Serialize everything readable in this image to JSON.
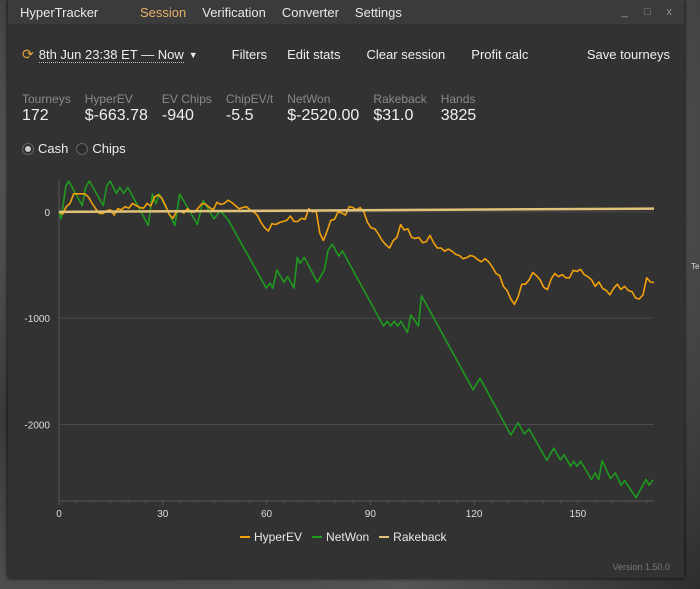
{
  "window": {
    "app_title": "HyperTracker",
    "nav": [
      "Session",
      "Verification",
      "Converter",
      "Settings"
    ],
    "active_nav": "Session",
    "controls": {
      "minimize": "_",
      "maximize": "□",
      "close": "x"
    }
  },
  "toolbar": {
    "date_range": "8th Jun 23:38 ET — Now",
    "filters": "Filters",
    "edit_stats": "Edit stats",
    "clear_session": "Clear session",
    "profit_calc": "Profit calc",
    "save_tourneys": "Save tourneys"
  },
  "stats": [
    {
      "label": "Tourneys",
      "value": "172"
    },
    {
      "label": "HyperEV",
      "value": "$-663.78"
    },
    {
      "label": "EV Chips",
      "value": "-940"
    },
    {
      "label": "ChipEV/t",
      "value": "-5.5"
    },
    {
      "label": "NetWon",
      "value": "$-2520.00"
    },
    {
      "label": "Rakeback",
      "value": "$31.0"
    },
    {
      "label": "Hands",
      "value": "3825"
    }
  ],
  "mode": {
    "options": [
      "Cash",
      "Chips"
    ],
    "selected": "Cash"
  },
  "version": "Version 1.50.0",
  "background_text": "Te",
  "colors": {
    "hyperev": "#f2a20c",
    "netwon": "#1f9a1f",
    "rakeback": "#e0c27a",
    "accent": "#e6b26a"
  },
  "chart_data": {
    "type": "line",
    "xlim": [
      0,
      172
    ],
    "ylim": [
      -2720,
      300
    ],
    "xticks": [
      0,
      30,
      60,
      90,
      120,
      150
    ],
    "yticks": [
      0,
      -1000,
      -2000
    ],
    "grid": "horizontal",
    "legend_position": "bottom",
    "series": [
      {
        "name": "HyperEV",
        "color": "#f2a20c",
        "x_range": [
          0,
          172
        ],
        "values": [
          0,
          -20,
          50,
          80,
          170,
          170,
          170,
          170,
          140,
          80,
          30,
          -15,
          -15,
          10,
          20,
          -30,
          30,
          20,
          50,
          35,
          80,
          60,
          40,
          35,
          80,
          55,
          140,
          160,
          130,
          60,
          -25,
          -60,
          0,
          10,
          -10,
          30,
          0,
          0,
          40,
          80,
          70,
          40,
          20,
          90,
          70,
          80,
          110,
          90,
          60,
          30,
          40,
          50,
          20,
          0,
          -30,
          -100,
          -150,
          -180,
          -110,
          -120,
          -100,
          -90,
          -80,
          -40,
          -90,
          -90,
          -60,
          -70,
          30,
          0,
          10,
          -200,
          -270,
          -180,
          -80,
          -70,
          0,
          -10,
          -30,
          50,
          40,
          20,
          40,
          0,
          -100,
          -150,
          -160,
          -210,
          -270,
          -310,
          -340,
          -270,
          -240,
          -120,
          -170,
          -160,
          -240,
          -250,
          -240,
          -290,
          -280,
          -220,
          -290,
          -340,
          -340,
          -370,
          -350,
          -370,
          -400,
          -410,
          -440,
          -430,
          -410,
          -420,
          -450,
          -470,
          -440,
          -470,
          -520,
          -580,
          -600,
          -700,
          -740,
          -820,
          -870,
          -800,
          -680,
          -680,
          -640,
          -570,
          -600,
          -640,
          -710,
          -730,
          -630,
          -580,
          -610,
          -590,
          -620,
          -620,
          -550,
          -560,
          -540,
          -590,
          -610,
          -640,
          -700,
          -660,
          -720,
          -740,
          -780,
          -720,
          -680,
          -730,
          -700,
          -740,
          -750,
          -810,
          -820,
          -780,
          -620,
          -660,
          -664
        ]
      },
      {
        "name": "NetWon",
        "color": "#1f9a1f",
        "points": [
          [
            0,
            0
          ],
          [
            0.6,
            -65
          ],
          [
            2,
            245
          ],
          [
            2.8,
            290
          ],
          [
            6.7,
            60
          ],
          [
            7.7,
            230
          ],
          [
            8.8,
            290
          ],
          [
            12.8,
            60
          ],
          [
            13.8,
            245
          ],
          [
            14.8,
            290
          ],
          [
            16.6,
            174
          ],
          [
            17.6,
            230
          ],
          [
            18.7,
            174
          ],
          [
            19.9,
            230
          ],
          [
            25.8,
            -127
          ],
          [
            27,
            168
          ],
          [
            28,
            75
          ],
          [
            29,
            168
          ],
          [
            33.5,
            -127
          ],
          [
            34.9,
            168
          ],
          [
            40,
            -118
          ],
          [
            41.7,
            105
          ],
          [
            44.8,
            -65
          ],
          [
            46.7,
            12
          ],
          [
            47.8,
            -34
          ],
          [
            48.9,
            -75
          ],
          [
            59.9,
            -717
          ],
          [
            61,
            -671
          ],
          [
            61.8,
            -717
          ],
          [
            63,
            -547
          ],
          [
            65,
            -662
          ],
          [
            66.1,
            -609
          ],
          [
            67.9,
            -717
          ],
          [
            68.9,
            -428
          ],
          [
            69.7,
            -484
          ],
          [
            70.9,
            -428
          ],
          [
            74.7,
            -662
          ],
          [
            76.7,
            -547
          ],
          [
            77.8,
            -360
          ],
          [
            79,
            -304
          ],
          [
            80.9,
            -416
          ],
          [
            81.9,
            -366
          ],
          [
            93.8,
            -1074
          ],
          [
            94.9,
            -1028
          ],
          [
            95.9,
            -1074
          ],
          [
            96.9,
            -1028
          ],
          [
            97.9,
            -1074
          ],
          [
            98.9,
            -1028
          ],
          [
            100.7,
            -1136
          ],
          [
            101.7,
            -968
          ],
          [
            103.9,
            -1074
          ],
          [
            104.8,
            -789
          ],
          [
            119.7,
            -1674
          ],
          [
            121.7,
            -1565
          ],
          [
            130.6,
            -2099
          ],
          [
            132.7,
            -1984
          ],
          [
            134.5,
            -2089
          ],
          [
            135.9,
            -2043
          ],
          [
            141,
            -2338
          ],
          [
            143,
            -2223
          ],
          [
            144.9,
            -2332
          ],
          [
            146,
            -2285
          ],
          [
            147.9,
            -2394
          ],
          [
            148.8,
            -2347
          ],
          [
            149.7,
            -2394
          ],
          [
            150.8,
            -2347
          ],
          [
            153.9,
            -2518
          ],
          [
            155,
            -2456
          ],
          [
            156,
            -2518
          ],
          [
            157,
            -2341
          ],
          [
            159.4,
            -2509
          ],
          [
            160.8,
            -2456
          ],
          [
            162.5,
            -2571
          ],
          [
            163.5,
            -2527
          ],
          [
            166.8,
            -2689
          ],
          [
            169.7,
            -2518
          ],
          [
            170.6,
            -2571
          ],
          [
            171.7,
            -2520
          ]
        ]
      },
      {
        "name": "Rakeback",
        "color": "#e0c27a",
        "points": [
          [
            0,
            0
          ],
          [
            172,
            31
          ]
        ]
      }
    ]
  }
}
